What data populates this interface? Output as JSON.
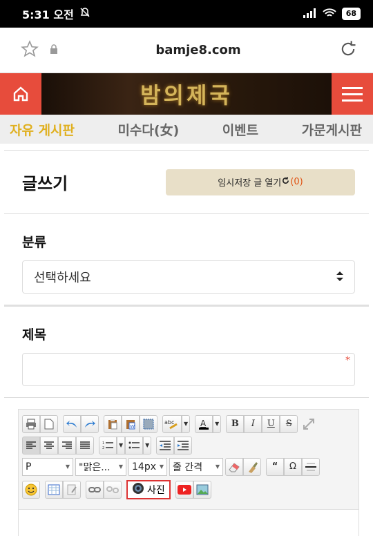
{
  "status": {
    "time": "5:31 오전",
    "battery": "68"
  },
  "browser": {
    "url": "bamje8.com"
  },
  "banner": {
    "title": "밤의제국"
  },
  "tabs": [
    {
      "label": "자유 게시판",
      "active": true
    },
    {
      "label": "미수다(女)",
      "active": false
    },
    {
      "label": "이벤트",
      "active": false
    },
    {
      "label": "가문게시판",
      "active": false
    }
  ],
  "write": {
    "heading": "글쓰기",
    "draft_label": "임시저장 글 열기",
    "draft_count": "(0)"
  },
  "category": {
    "label": "분류",
    "selected": "선택하세요"
  },
  "subject": {
    "label": "제목",
    "value": "",
    "required_mark": "*"
  },
  "editor": {
    "font_style": "P",
    "font_family": "\"맑은...",
    "font_size": "14px",
    "line_height": "줄 간격",
    "photo_label": "사진",
    "bold": "B",
    "italic": "I",
    "underline": "U",
    "strike": "S",
    "quote": "“",
    "omega": "Ω"
  },
  "colors": {
    "accent": "#e74c3c",
    "active_tab": "#e0b020",
    "draft_bg": "#e8dfc8"
  }
}
